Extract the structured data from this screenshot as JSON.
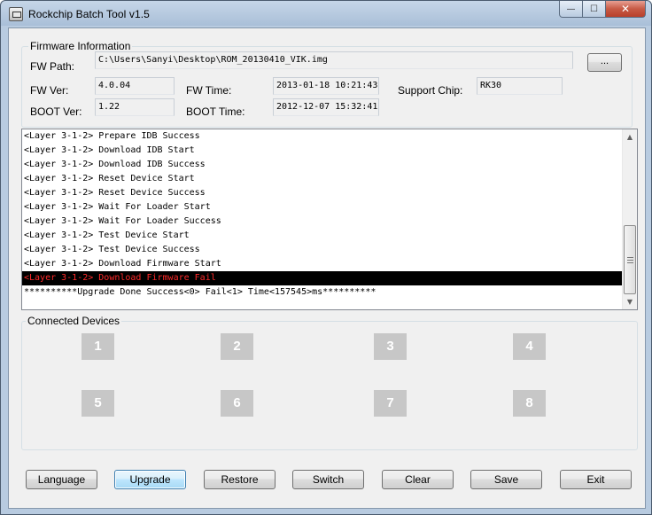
{
  "window": {
    "title": "Rockchip Batch Tool v1.5",
    "controls": {
      "minimize": "—",
      "maximize": "☐",
      "close": "✕"
    }
  },
  "firmware": {
    "group_label": "Firmware Information",
    "fw_path_label": "FW Path:",
    "fw_path_value": "C:\\Users\\Sanyi\\Desktop\\ROM_20130410_VIK.img",
    "browse_label": "...",
    "fw_ver_label": "FW Ver:",
    "fw_ver_value": "4.0.04",
    "fw_time_label": "FW Time:",
    "fw_time_value": "2013-01-18 10:21:43",
    "support_chip_label": "Support Chip:",
    "support_chip_value": "RK30",
    "boot_ver_label": "BOOT Ver:",
    "boot_ver_value": "1.22",
    "boot_time_label": "BOOT Time:",
    "boot_time_value": "2012-12-07 15:32:41"
  },
  "log": {
    "lines": [
      "<Layer 3-1-2> Prepare IDB Success",
      "<Layer 3-1-2> Download IDB Start",
      "<Layer 3-1-2> Download IDB Success",
      "<Layer 3-1-2> Reset Device Start",
      "<Layer 3-1-2> Reset Device Success",
      "<Layer 3-1-2> Wait For Loader Start",
      "<Layer 3-1-2> Wait For Loader Success",
      "<Layer 3-1-2> Test Device Start",
      "<Layer 3-1-2> Test Device Success",
      "<Layer 3-1-2> Download Firmware Start",
      "<Layer 3-1-2> Download Firmware Fail",
      "**********Upgrade Done Success<0> Fail<1> Time<157545>ms**********"
    ],
    "highlighted_index": 10,
    "highlight_text_color": "#ff2a2a",
    "scroll_up": "▲",
    "scroll_down": "▼"
  },
  "devices": {
    "group_label": "Connected Devices",
    "slots": [
      "1",
      "2",
      "3",
      "4",
      "5",
      "6",
      "7",
      "8"
    ]
  },
  "buttons": {
    "language": "Language",
    "upgrade": "Upgrade",
    "restore": "Restore",
    "switch": "Switch",
    "clear": "Clear",
    "save": "Save",
    "exit": "Exit"
  }
}
